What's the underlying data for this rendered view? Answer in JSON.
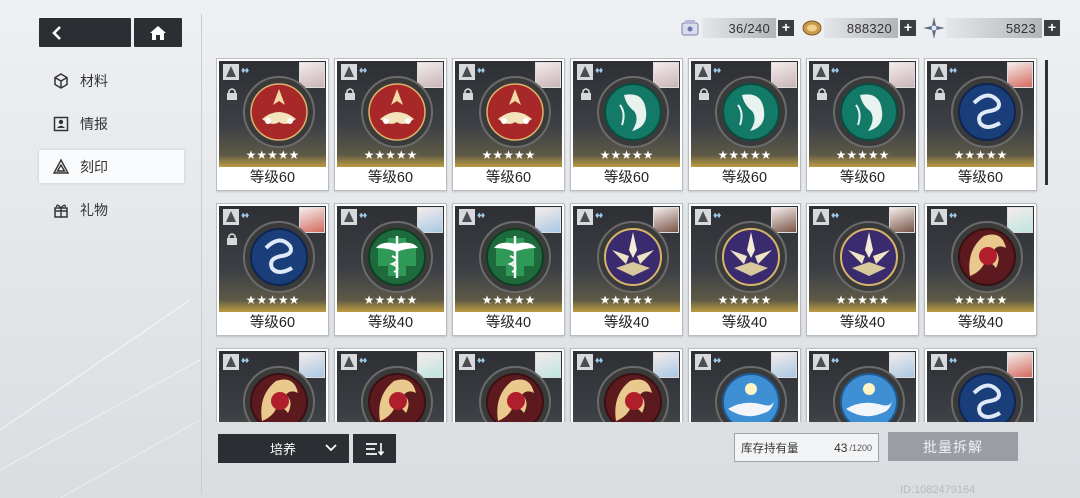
{
  "nav": {
    "back_icon": "back-arrow-icon",
    "home_icon": "home-icon"
  },
  "menu": [
    {
      "label": "材料",
      "icon": "cube-icon",
      "active": false
    },
    {
      "label": "情报",
      "icon": "profile-card-icon",
      "active": false
    },
    {
      "label": "刻印",
      "icon": "imprint-icon",
      "active": true
    },
    {
      "label": "礼物",
      "icon": "gift-icon",
      "active": false
    }
  ],
  "currency": {
    "capacity": "36/240",
    "coins": "888320",
    "crystals": "5823"
  },
  "cards": [
    {
      "level": "等级60",
      "stars": "★★★★★",
      "emblem": "red-lotus-emblem",
      "locked": true
    },
    {
      "level": "等级60",
      "stars": "★★★★★",
      "emblem": "red-lotus-emblem",
      "locked": true
    },
    {
      "level": "等级60",
      "stars": "★★★★★",
      "emblem": "red-lotus-emblem",
      "locked": true
    },
    {
      "level": "等级60",
      "stars": "★★★★★",
      "emblem": "green-maiden-emblem",
      "locked": true
    },
    {
      "level": "等级60",
      "stars": "★★★★★",
      "emblem": "green-maiden-emblem",
      "locked": true
    },
    {
      "level": "等级60",
      "stars": "★★★★★",
      "emblem": "green-maiden-emblem",
      "locked": true
    },
    {
      "level": "等级60",
      "stars": "★★★★★",
      "emblem": "blue-swirl-emblem",
      "locked": true
    },
    {
      "level": "等级60",
      "stars": "★★★★★",
      "emblem": "blue-swirl-emblem",
      "locked": true
    },
    {
      "level": "等级40",
      "stars": "★★★★★",
      "emblem": "green-caduceus-emblem",
      "locked": false
    },
    {
      "level": "等级40",
      "stars": "★★★★★",
      "emblem": "green-caduceus-emblem",
      "locked": false
    },
    {
      "level": "等级40",
      "stars": "★★★★★",
      "emblem": "purple-crest-emblem",
      "locked": false
    },
    {
      "level": "等级40",
      "stars": "★★★★★",
      "emblem": "purple-crest-emblem",
      "locked": false
    },
    {
      "level": "等级40",
      "stars": "★★★★★",
      "emblem": "purple-crest-emblem",
      "locked": false
    },
    {
      "level": "等级40",
      "stars": "★★★★★",
      "emblem": "golden-beast-emblem",
      "locked": false
    },
    {
      "level": "",
      "stars": "",
      "emblem": "golden-beast-emblem",
      "locked": false
    },
    {
      "level": "",
      "stars": "",
      "emblem": "golden-beast-emblem",
      "locked": false
    },
    {
      "level": "",
      "stars": "",
      "emblem": "golden-beast-emblem",
      "locked": false
    },
    {
      "level": "",
      "stars": "",
      "emblem": "golden-beast-emblem",
      "locked": false
    },
    {
      "level": "",
      "stars": "",
      "emblem": "blue-whale-emblem",
      "locked": false
    },
    {
      "level": "",
      "stars": "",
      "emblem": "blue-whale-emblem",
      "locked": false
    },
    {
      "level": "",
      "stars": "",
      "emblem": "blue-swirl-emblem",
      "locked": false
    }
  ],
  "bottom": {
    "dropdown_label": "培养",
    "stock_label": "库存持有量",
    "stock_value": "43",
    "stock_max": "/1200",
    "dismantle_label": "批量拆解"
  },
  "uid": "ID:1082479164",
  "colors": {
    "dark_button": "#2b2e33",
    "accent_gold": "#e0a83a",
    "disabled_button": "#9a9ea4"
  }
}
